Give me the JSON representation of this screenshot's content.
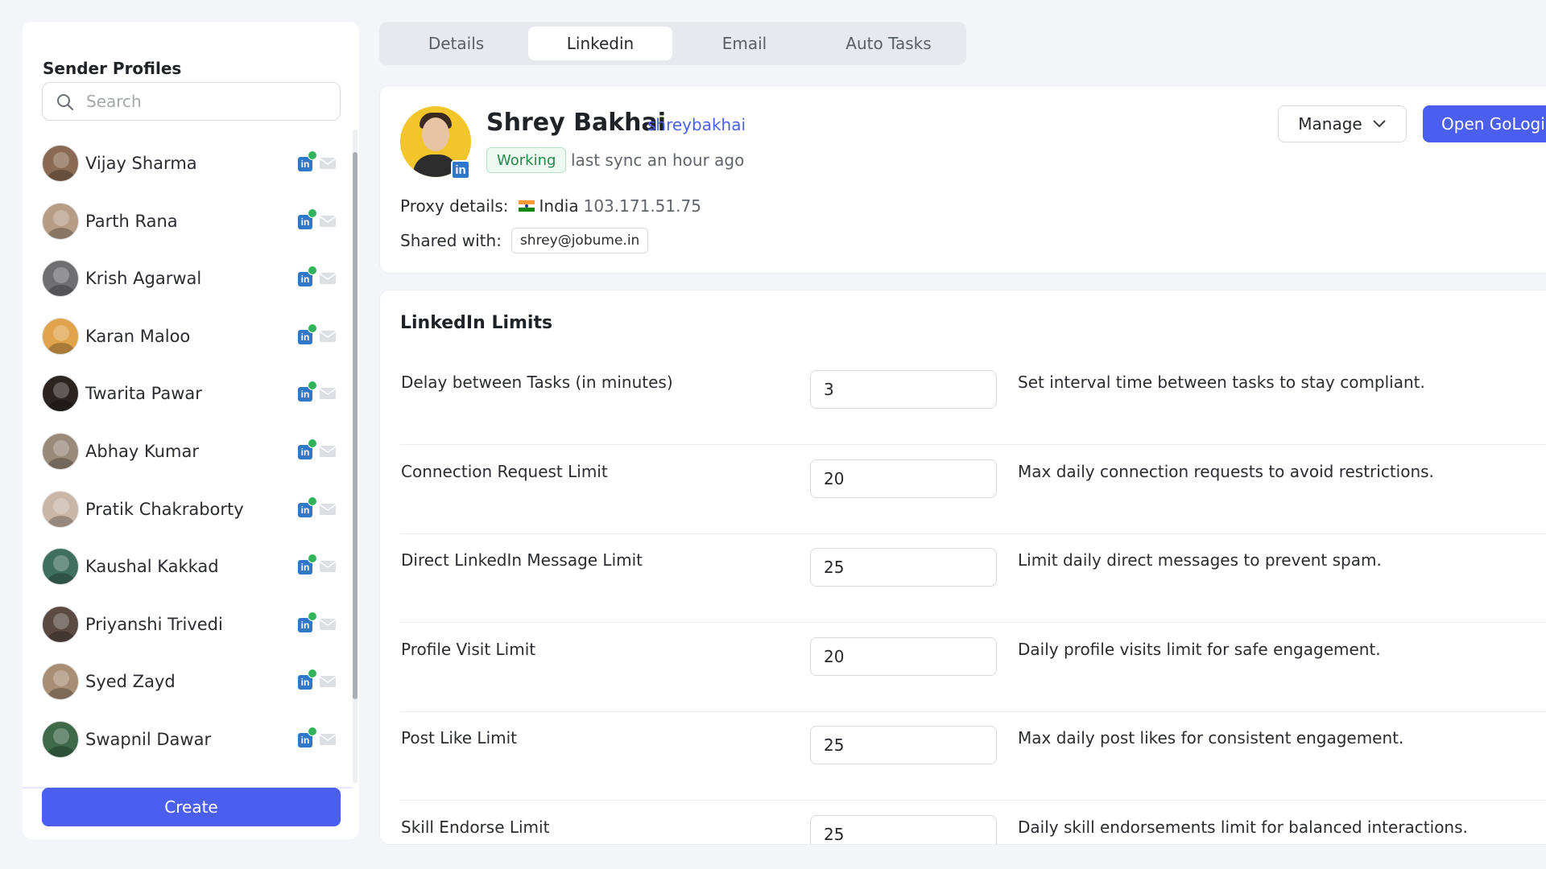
{
  "sidebar": {
    "title": "Sender Profiles",
    "search_placeholder": "Search",
    "profiles": [
      {
        "name": "Vijay Sharma",
        "color": "#8a6a52"
      },
      {
        "name": "Parth Rana",
        "color": "#b79d86"
      },
      {
        "name": "Krish Agarwal",
        "color": "#6f6f72"
      },
      {
        "name": "Karan Maloo",
        "color": "#e0a24a"
      },
      {
        "name": "Twarita Pawar",
        "color": "#2b2420"
      },
      {
        "name": "Abhay Kumar",
        "color": "#9a8a7a"
      },
      {
        "name": "Pratik Chakraborty",
        "color": "#c9b6a6"
      },
      {
        "name": "Kaushal Kakkad",
        "color": "#3f6f5f"
      },
      {
        "name": "Priyanshi Trivedi",
        "color": "#5a4a42"
      },
      {
        "name": "Syed Zayd",
        "color": "#a88e74"
      },
      {
        "name": "Swapnil Dawar",
        "color": "#3e6a4a"
      }
    ],
    "create_label": "Create"
  },
  "tabs": [
    {
      "label": "Details",
      "active": false
    },
    {
      "label": "Linkedin",
      "active": true
    },
    {
      "label": "Email",
      "active": false
    },
    {
      "label": "Auto Tasks",
      "active": false
    }
  ],
  "profile": {
    "name": "Shrey Bakhai",
    "handle": "shreybakhai",
    "status": "Working",
    "sync": "last sync an hour ago",
    "proxy_label": "Proxy details:",
    "proxy_country": "India",
    "proxy_ip": "103.171.51.75",
    "shared_label": "Shared with:",
    "shared_with": "shrey@jobume.in",
    "manage_label": "Manage",
    "open_label": "Open GoLogin"
  },
  "limits": {
    "title": "LinkedIn Limits",
    "rows": [
      {
        "label": "Delay between Tasks (in minutes)",
        "value": "3",
        "desc": "Set interval time between tasks to stay compliant."
      },
      {
        "label": "Connection Request Limit",
        "value": "20",
        "desc": "Max daily connection requests to avoid restrictions."
      },
      {
        "label": "Direct LinkedIn Message Limit",
        "value": "25",
        "desc": "Limit daily direct messages to prevent spam."
      },
      {
        "label": "Profile Visit Limit",
        "value": "20",
        "desc": "Daily profile visits limit for safe engagement."
      },
      {
        "label": "Post Like Limit",
        "value": "25",
        "desc": "Max daily post likes for consistent engagement."
      },
      {
        "label": "Skill Endorse Limit",
        "value": "25",
        "desc": "Daily skill endorsements limit for balanced interactions."
      }
    ]
  },
  "colors": {
    "accent": "#4a5ef0",
    "linkedin": "#2f77c8",
    "success": "#23884a"
  }
}
